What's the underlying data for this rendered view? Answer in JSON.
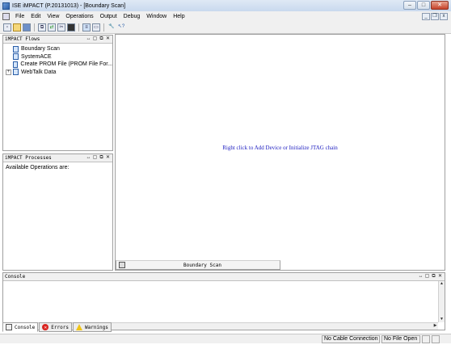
{
  "window": {
    "title": "ISE iMPACT (P.20131013) - [Boundary Scan]",
    "controls": {
      "minimize": "–",
      "maximize": "□",
      "close": "✕"
    }
  },
  "menu": {
    "items": [
      "File",
      "Edit",
      "View",
      "Operations",
      "Output",
      "Debug",
      "Window",
      "Help"
    ]
  },
  "toolbar": {
    "icons": [
      "new-file-icon",
      "open-folder-icon",
      "save-icon",
      "copy-icon",
      "arrows-icon",
      "scissors-icon",
      "chip-icon",
      "layout-icon",
      "window-icon",
      "wrench-icon",
      "help-pointer-icon"
    ]
  },
  "flows_panel": {
    "title": "iMPACT Flows",
    "items": [
      {
        "label": "Boundary Scan",
        "expandable": false
      },
      {
        "label": "SystemACE",
        "expandable": false
      },
      {
        "label": "Create PROM File (PROM File For...",
        "expandable": false
      },
      {
        "label": "WebTalk Data",
        "expandable": true
      }
    ]
  },
  "processes_panel": {
    "title": "iMPACT Processes",
    "body_text": "Available Operations are:"
  },
  "panel_controls": {
    "move": "↔",
    "minimize": "▢",
    "float": "⧉",
    "close": "✕"
  },
  "main": {
    "hint": "Right click to Add Device or Initialize JTAG chain",
    "tab_label": "Boundary Scan",
    "hint_color": "#1c1cc0"
  },
  "console": {
    "title": "Console",
    "tabs": [
      "Console",
      "Errors",
      "Warnings"
    ]
  },
  "status": {
    "cable": "No Cable Connection",
    "file": "No File Open"
  }
}
